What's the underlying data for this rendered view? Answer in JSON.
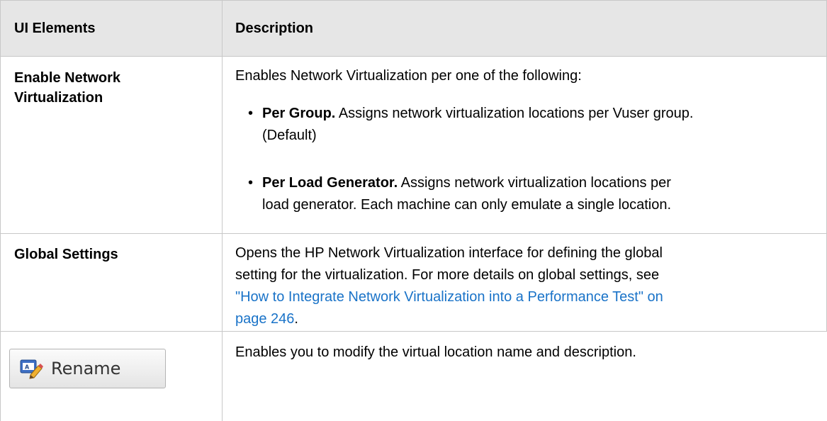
{
  "table": {
    "headers": {
      "col1": "UI Elements",
      "col2": "Description"
    },
    "rows": [
      {
        "label_line1": "Enable Network",
        "label_line2": "Virtualization",
        "desc_intro": "Enables Network Virtualization per one of the following:",
        "bullets": [
          {
            "bold": "Per Group.",
            "text_line1": " Assigns network virtualization locations per Vuser group.",
            "text_line2": "(Default)"
          },
          {
            "bold": "Per Load Generator.",
            "text_line1": " Assigns network virtualization locations per",
            "text_line2": "load generator. Each machine can only emulate a single location."
          }
        ]
      },
      {
        "label": "Global Settings",
        "desc_line1": "Opens the HP Network Virtualization interface for defining the global",
        "desc_line2": "setting for the virtualization. For more details on global settings, see",
        "link_line1": "\"How to Integrate Network Virtualization into a Performance Test\" on",
        "link_line2": "page 246",
        "link_suffix": "."
      },
      {
        "button_label": "Rename",
        "button_icon": "rename-icon",
        "desc": "Enables you to modify the virtual location name and description."
      }
    ]
  },
  "colors": {
    "header_bg": "#e6e6e6",
    "link": "#1a73c8",
    "border": "#c8c8c8"
  }
}
